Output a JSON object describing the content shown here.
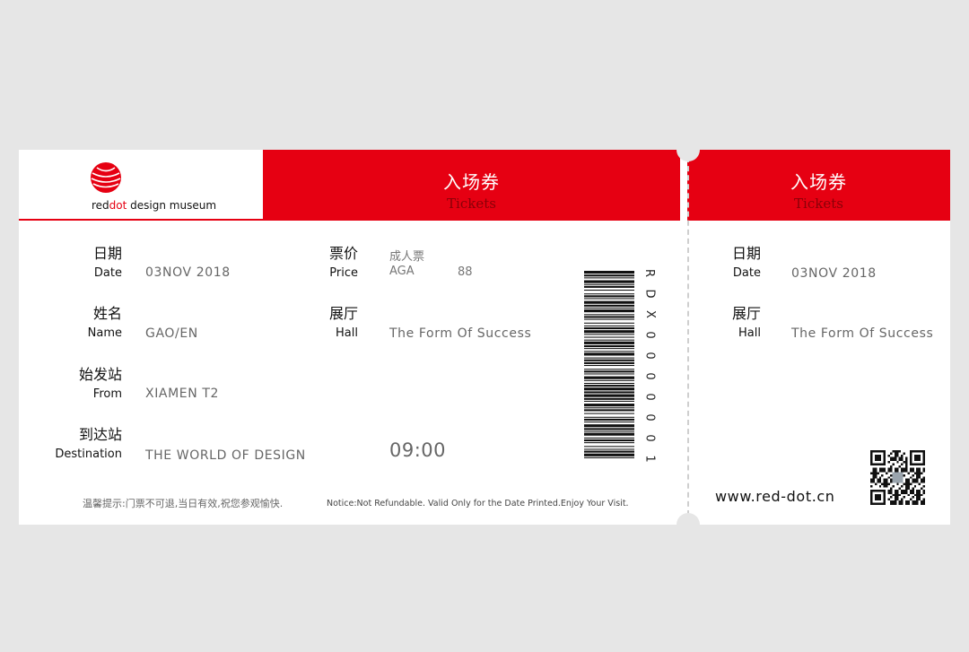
{
  "brand": {
    "part1": "red",
    "part2": "dot",
    "rest": " design museum",
    "color": "#e60012"
  },
  "header": {
    "title_cn": "入场券",
    "title_en": "Tickets"
  },
  "stub_header": {
    "title_cn": "入场券",
    "title_en": "Tickets"
  },
  "main": {
    "date": {
      "label_cn": "日期",
      "label_en": "Date",
      "value": "03NOV 2018"
    },
    "name": {
      "label_cn": "姓名",
      "label_en": "Name",
      "value": "GAO/EN"
    },
    "from": {
      "label_cn": "始发站",
      "label_en": "From",
      "value": "XIAMEN T2"
    },
    "destination": {
      "label_cn": "到达站",
      "label_en": "Destination",
      "value": "THE WORLD OF DESIGN"
    },
    "price": {
      "label_cn": "票价",
      "label_en": "Price",
      "type": "成人票",
      "code": "AGA",
      "amount": "88"
    },
    "hall": {
      "label_cn": "展厅",
      "label_en": "Hall",
      "value": "The Form Of Success"
    },
    "time": "09:00"
  },
  "serial": [
    "R",
    "D",
    "X",
    "0",
    "0",
    "0",
    "0",
    "0",
    "0",
    "1"
  ],
  "notice": {
    "cn": "温馨提示:门票不可退,当日有效,祝您参观愉快.",
    "en": "Notice:Not Refundable. Valid Only for the Date Printed.Enjoy Your Visit."
  },
  "stub": {
    "date": {
      "label_cn": "日期",
      "label_en": "Date",
      "value": "03NOV 2018"
    },
    "hall": {
      "label_cn": "展厅",
      "label_en": "Hall",
      "value": "The Form Of Success"
    },
    "website": "www.red-dot.cn"
  },
  "icons": [
    "reddot-logo-icon",
    "barcode-icon",
    "qr-code-icon"
  ]
}
